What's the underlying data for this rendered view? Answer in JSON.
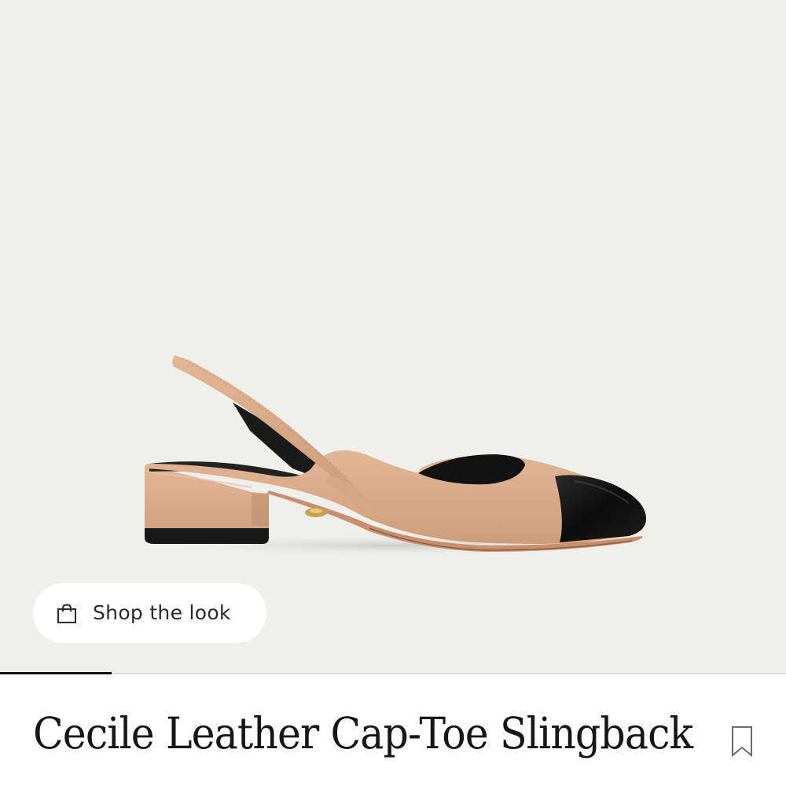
{
  "product": {
    "title": "Cecile Leather Cap-Toe Slingback",
    "image_alt": "Cecile Leather Cap-Toe Slingback"
  },
  "shop_the_look": {
    "label": "Shop the look",
    "icon": "shopping-bag-icon"
  },
  "carousel": {
    "progress": 0.142
  },
  "bookmark": {
    "icon": "bookmark-icon"
  },
  "colors": {
    "background": "#efefed",
    "leather": "#d9aa86",
    "cap_toe": "#111111",
    "text": "#161616"
  }
}
